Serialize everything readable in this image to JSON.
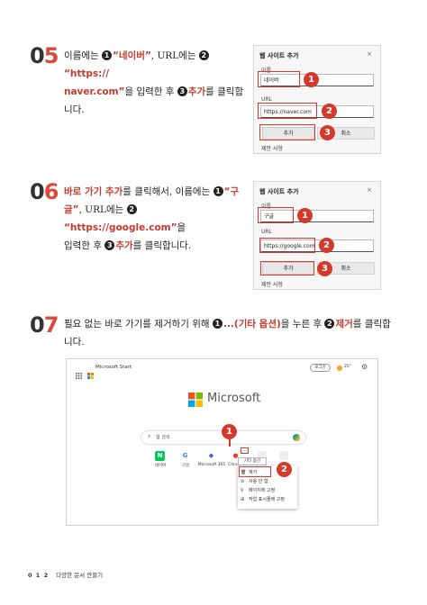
{
  "step5": {
    "num_a": "0",
    "num_b": "5",
    "l1_a": "이름에는 ",
    "c1": "1",
    "l1_b": "“네이버”",
    "l1_c": ", URL에는 ",
    "c2": "2",
    "l1_d": "“https://",
    "l2_a": "naver.com”",
    "l2_b": "을 입력한 후 ",
    "c3": "3",
    "l2_c": "추가",
    "l2_d": "를 클릭합",
    "l3": "니다.",
    "dialog": {
      "title": "웹 사이트 추가",
      "close": "×",
      "name_label": "이름",
      "name_value": "네이버",
      "url_label": "URL",
      "url_value": "https://naver.com",
      "add_label": "추가",
      "cancel_label": "취소",
      "footer": "제안 사항"
    },
    "badges": [
      "1",
      "2",
      "3"
    ]
  },
  "step6": {
    "num_a": "0",
    "num_b": "6",
    "l1_a": "바로 가기 추가",
    "l1_b": "를 클릭해서, 이름에는 ",
    "c1": "1",
    "l1_c": "“구",
    "l2_a": "글”",
    "l2_b": ", URL에는 ",
    "c2": "2",
    "l2_c": "“https://google.com”",
    "l2_d": "을",
    "l3_a": "입력한 후 ",
    "c3": "3",
    "l3_b": "추가",
    "l3_c": "를 클릭합니다.",
    "dialog": {
      "title": "웹 사이트 추가",
      "close": "×",
      "name_label": "이름",
      "name_value": "구글",
      "url_label": "URL",
      "url_value": "https://google.com",
      "add_label": "추가",
      "cancel_label": "취소",
      "footer": "제안 사항"
    },
    "badges": [
      "1",
      "2",
      "3"
    ]
  },
  "step7": {
    "num_a": "0",
    "num_b": "7",
    "l1_a": "필요 없는 바로 가기를 제거하기 위해 ",
    "c1": "1",
    "l1_b": "...(기타 옵션)",
    "l1_c": "을 누른 후 ",
    "c2": "2",
    "l1_d": "제거",
    "l1_e": "를 클릭합",
    "l2": "니다.",
    "browser": {
      "app_name": "Microsoft Start",
      "login": "로그인",
      "weather": "25°",
      "logo_text": "Microsoft",
      "search_placeholder": "웹 검색",
      "tiles": [
        {
          "label": "네이버",
          "glyph": "N",
          "color": "#03c75a"
        },
        {
          "label": "구글",
          "glyph": "G",
          "color": "#4285f4"
        },
        {
          "label": "Microsoft 365",
          "glyph": "◆",
          "color": "#d83b01"
        },
        {
          "label": "Chrome",
          "glyph": "●",
          "color": "#ea4335"
        }
      ],
      "more_button": "...",
      "tooltip": "기타 옵션",
      "menu": [
        {
          "label": "제거",
          "icon": "🗑"
        },
        {
          "label": "사용 안 함",
          "icon": "⊘"
        },
        {
          "label": "페이지에 고정",
          "icon": "📌"
        },
        {
          "label": "작업 표시줄에 고정",
          "icon": "⊞"
        }
      ]
    },
    "badges": [
      "1",
      "2"
    ]
  },
  "footer": {
    "page": "0 1 2",
    "title": "다양한 문서 만들기"
  },
  "colors": {
    "accent_red": "#d33a2c",
    "text": "#222222"
  }
}
